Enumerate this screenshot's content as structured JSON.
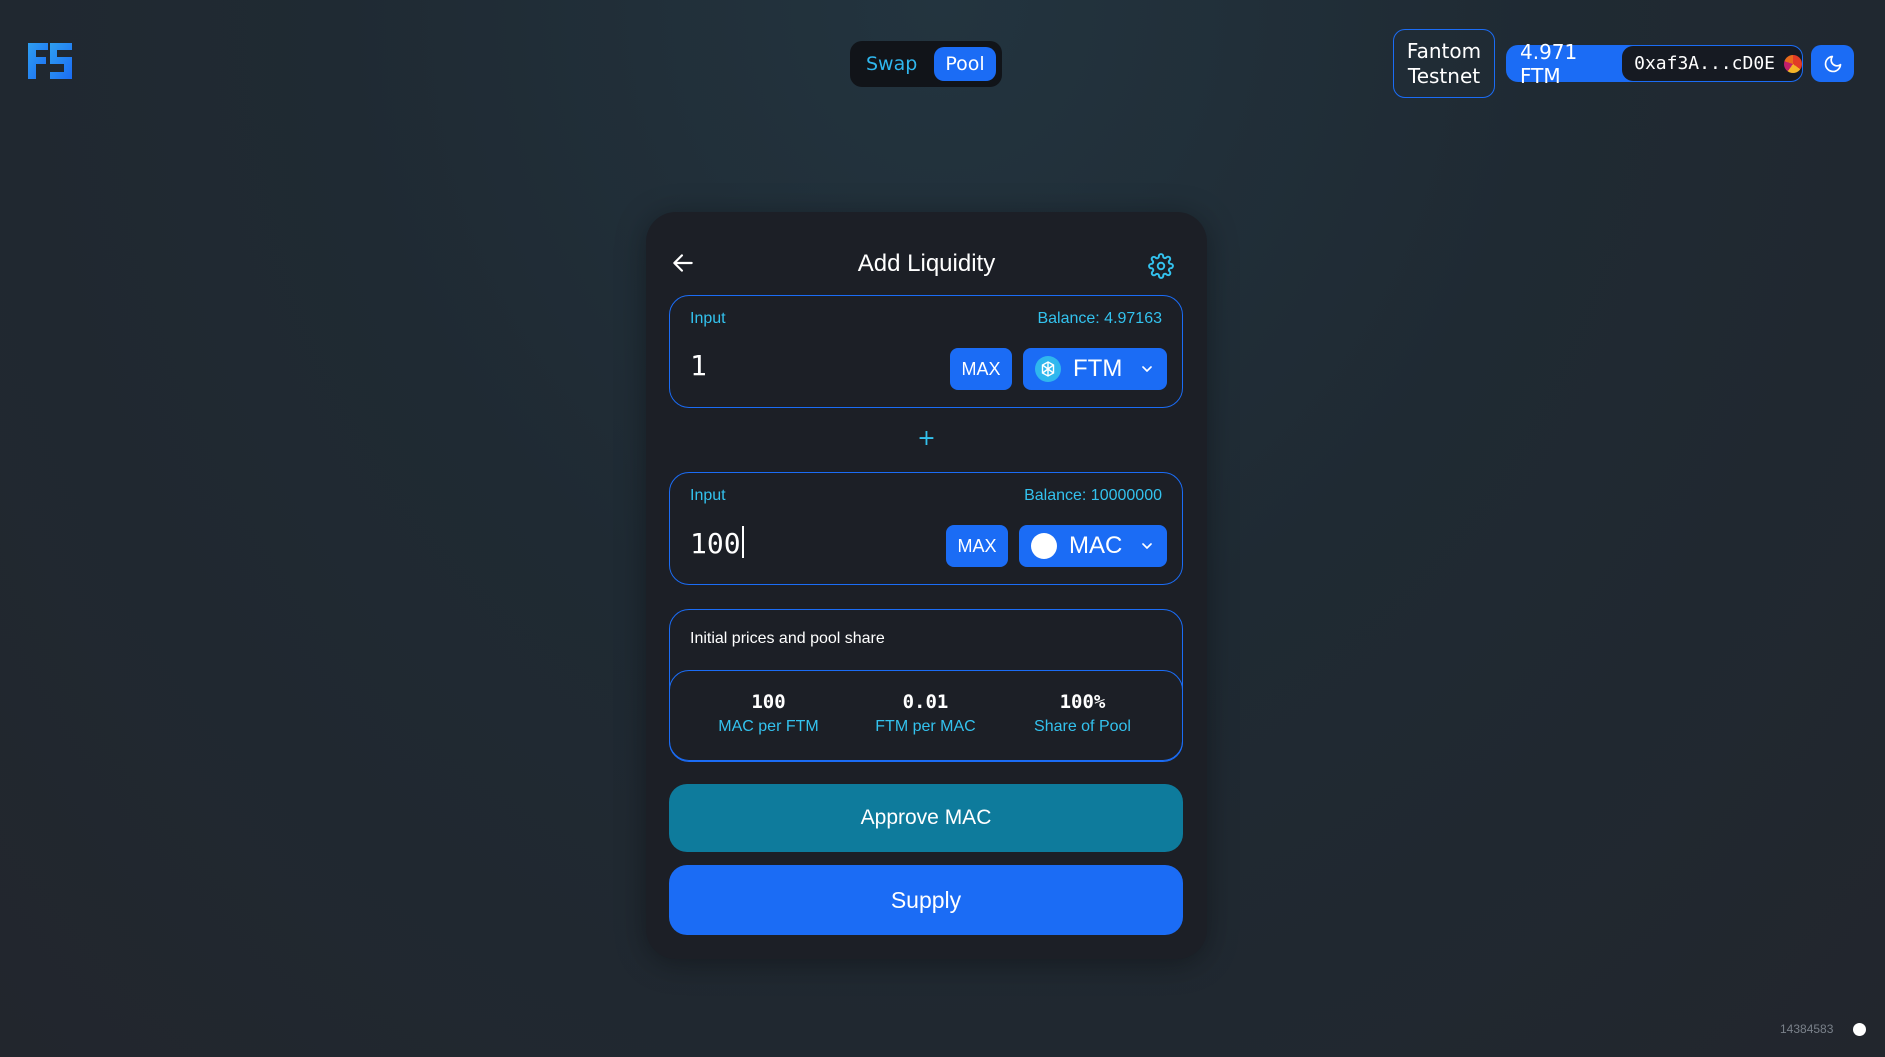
{
  "header": {
    "logo_icon": "fs-logo-icon",
    "nav": {
      "swap_label": "Swap",
      "pool_label": "Pool",
      "active": "Pool"
    },
    "network": {
      "line1": "Fantom",
      "line2": "Testnet"
    },
    "wallet": {
      "balance": "4.971 FTM",
      "address": "0xaf3A...cD0E"
    },
    "theme_icon": "moon-icon"
  },
  "card": {
    "title": "Add Liquidity",
    "back_icon": "arrow-left-icon",
    "settings_icon": "gear-icon",
    "input_a": {
      "label": "Input",
      "balance": "Balance: 4.97163",
      "value": "1",
      "max_label": "MAX",
      "token": "FTM",
      "token_icon": "fantom-token-icon"
    },
    "plus": "+",
    "input_b": {
      "label": "Input",
      "balance": "Balance: 10000000",
      "value": "100",
      "max_label": "MAX",
      "token": "MAC",
      "token_icon": "blank-token-icon"
    },
    "prices": {
      "title": "Initial prices and pool share",
      "stats": [
        {
          "value": "100",
          "caption": "MAC per FTM"
        },
        {
          "value": "0.01",
          "caption": "FTM per MAC"
        },
        {
          "value": "100%",
          "caption": "Share of Pool"
        }
      ]
    },
    "approve_label": "Approve MAC",
    "supply_label": "Supply"
  },
  "footer": {
    "block_number": "14384583"
  },
  "colors": {
    "accent": "#1b6cf5",
    "cyan": "#33c2ee",
    "approve": "#0e7b9c",
    "card_bg": "#1c1f26"
  }
}
